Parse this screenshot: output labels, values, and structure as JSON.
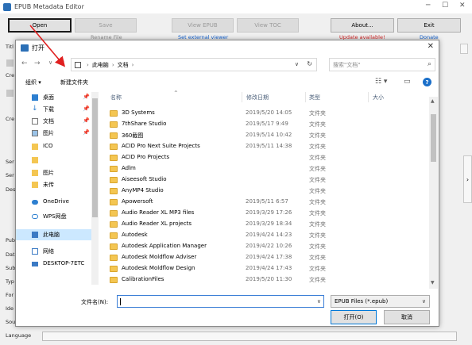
{
  "app": {
    "title": "EPUB Metadata Editor",
    "buttons": {
      "open": "Open",
      "save": "Save",
      "view_epub": "View EPUB",
      "view_toc": "View TOC",
      "about": "About...",
      "exit": "Exit"
    },
    "sublabels": {
      "rename": "Rename File",
      "external_viewer": "Set external viewer",
      "update": "Update available!",
      "donate": "Donate"
    },
    "left_labels": [
      "Titl",
      "Cre",
      "Cre",
      "Ser",
      "Ser",
      "Des",
      "Pub",
      "Dat",
      "Sub",
      "Typ",
      "For",
      "Ide",
      "Sou"
    ],
    "language_label": "Language"
  },
  "dialog": {
    "title": "打开",
    "address": {
      "root": "此电脑",
      "folder": "文档"
    },
    "search_placeholder": "搜索\"文档\"",
    "toolbar": {
      "organize": "组织",
      "new_folder": "新建文件夹"
    },
    "columns": {
      "name": "名称",
      "date": "修改日期",
      "type": "类型",
      "size": "大小"
    },
    "nav_items": [
      {
        "label": "桌面",
        "pinned": true,
        "icon": "desktop-icon"
      },
      {
        "label": "下载",
        "pinned": true,
        "icon": "download-icon"
      },
      {
        "label": "文档",
        "pinned": true,
        "icon": "document-icon"
      },
      {
        "label": "图片",
        "pinned": true,
        "icon": "picture-icon"
      },
      {
        "label": "ICO",
        "pinned": false,
        "icon": "folder-icon"
      },
      {
        "label": "",
        "pinned": false,
        "icon": "folder-icon"
      },
      {
        "label": "图片",
        "pinned": false,
        "icon": "folder-icon"
      },
      {
        "label": "未传",
        "pinned": false,
        "icon": "folder-icon"
      },
      {
        "label": "OneDrive",
        "pinned": false,
        "icon": "cloud-icon"
      },
      {
        "label": "WPS网盘",
        "pinned": false,
        "icon": "cloud-icon"
      },
      {
        "label": "此电脑",
        "pinned": false,
        "icon": "computer-icon",
        "selected": true
      },
      {
        "label": "网络",
        "pinned": false,
        "icon": "network-icon"
      },
      {
        "label": "DESKTOP-7ETC",
        "pinned": false,
        "icon": "monitor-icon"
      }
    ],
    "files": [
      {
        "name": "3D Systems",
        "date": "2019/5/20 14:05",
        "type": "文件夹"
      },
      {
        "name": "7thShare Studio",
        "date": "2019/5/17 9:49",
        "type": "文件夹"
      },
      {
        "name": "360截图",
        "date": "2019/5/14 10:42",
        "type": "文件夹"
      },
      {
        "name": "ACID Pro Next Suite Projects",
        "date": "2019/5/11 14:38",
        "type": "文件夹"
      },
      {
        "name": "ACID Pro Projects",
        "date": "",
        "type": "文件夹"
      },
      {
        "name": "Adlm",
        "date": "",
        "type": "文件夹"
      },
      {
        "name": "Aiseesoft Studio",
        "date": "",
        "type": "文件夹"
      },
      {
        "name": "AnyMP4 Studio",
        "date": "",
        "type": "文件夹"
      },
      {
        "name": "Apowersoft",
        "date": "2019/5/11 6:57",
        "type": "文件夹"
      },
      {
        "name": "Audio Reader XL MP3 files",
        "date": "2019/3/29 17:26",
        "type": "文件夹"
      },
      {
        "name": "Audio Reader XL projects",
        "date": "2019/3/29 18:34",
        "type": "文件夹"
      },
      {
        "name": "Autodesk",
        "date": "2019/4/24 14:23",
        "type": "文件夹"
      },
      {
        "name": "Autodesk Application Manager",
        "date": "2019/4/22 10:26",
        "type": "文件夹"
      },
      {
        "name": "Autodesk Moldflow Adviser",
        "date": "2019/4/24 17:38",
        "type": "文件夹"
      },
      {
        "name": "Autodesk Moldflow Design",
        "date": "2019/4/24 17:43",
        "type": "文件夹"
      },
      {
        "name": "CalibrationFiles",
        "date": "2019/5/20 11:30",
        "type": "文件夹"
      }
    ],
    "filename_label": "文件名(N):",
    "filename_value": "",
    "filetype": "EPUB Files (*.epub)",
    "open_button": "打开(O)",
    "cancel_button": "取消"
  },
  "colors": {
    "accent": "#0078d7",
    "annotation": "#e02020",
    "selected": "#cce8ff"
  }
}
